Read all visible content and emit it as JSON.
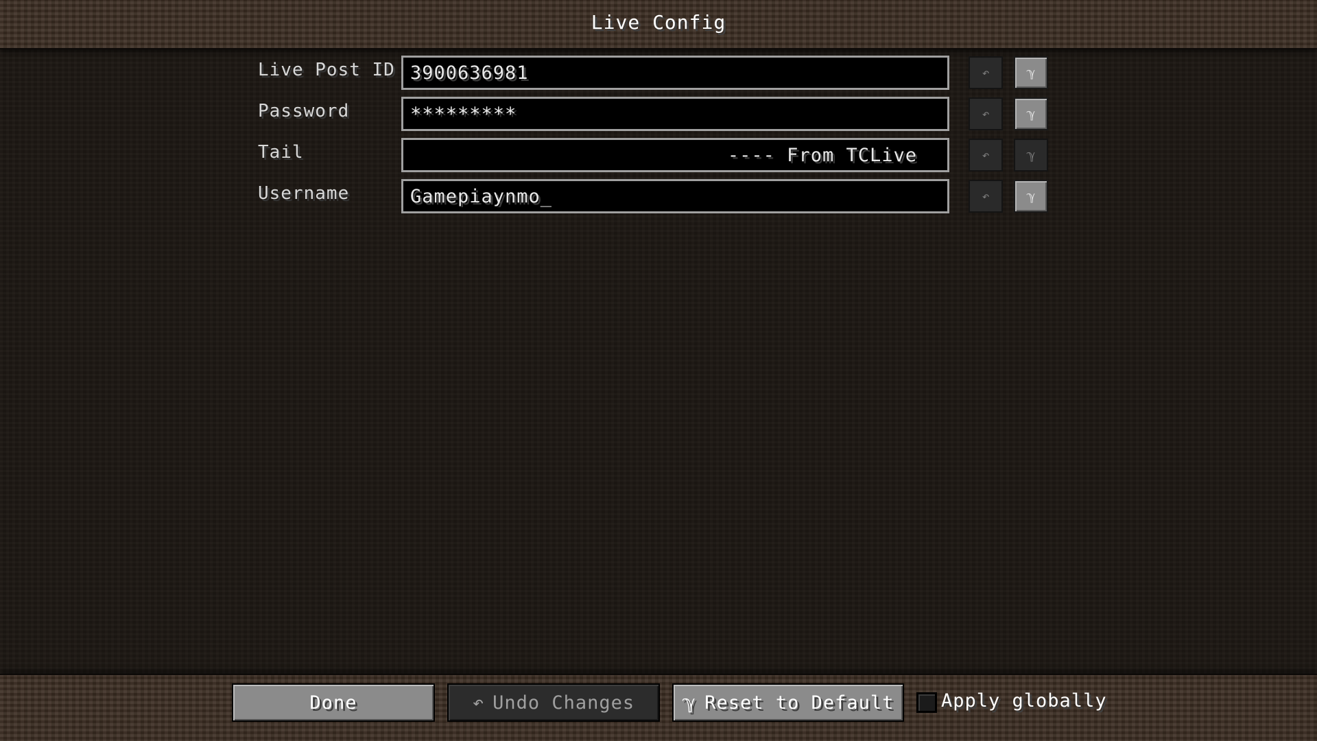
{
  "screen": {
    "title": "Live Config"
  },
  "fields": [
    {
      "label": "Live Post ID",
      "value": "3900636981"
    },
    {
      "label": "Password",
      "value": "*********"
    },
    {
      "label": "Tail",
      "value": "---- From TCLive"
    },
    {
      "label": "Username",
      "value": "Gamepiaynmo_"
    }
  ],
  "icons": {
    "undo": "↶",
    "reset": "ℽ"
  },
  "buttons": {
    "done": "Done",
    "undo_changes": "Undo Changes",
    "reset_to_default": "Reset to Default"
  },
  "apply_globally": {
    "label": "Apply globally",
    "checked": false
  },
  "colors": {
    "background": "#1c1712",
    "band": "#3a2c21",
    "input_border": "#a0a0a0",
    "button_active": "#8b8b8b",
    "button_disabled": "#2c2c2c"
  }
}
